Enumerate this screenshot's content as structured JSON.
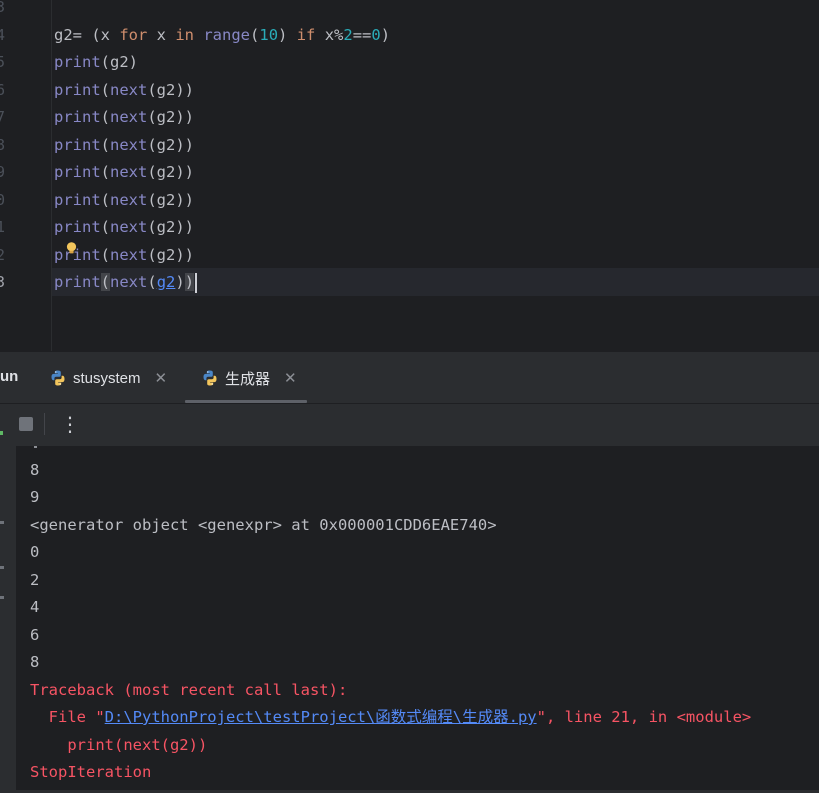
{
  "editor": {
    "line_numbers": [
      "3",
      "4",
      "5",
      "6",
      "7",
      "8",
      "9",
      "0",
      "1",
      "2",
      "3"
    ],
    "lines": [
      {
        "parts": []
      },
      {
        "parts": [
          {
            "t": "g2= (x ",
            "c": ""
          },
          {
            "t": "for",
            "c": "kw"
          },
          {
            "t": " x ",
            "c": ""
          },
          {
            "t": "in",
            "c": "kw"
          },
          {
            "t": " ",
            "c": ""
          },
          {
            "t": "range",
            "c": "bi"
          },
          {
            "t": "(",
            "c": ""
          },
          {
            "t": "10",
            "c": "num"
          },
          {
            "t": ") ",
            "c": ""
          },
          {
            "t": "if",
            "c": "kw"
          },
          {
            "t": " x%",
            "c": ""
          },
          {
            "t": "2",
            "c": "num"
          },
          {
            "t": "==",
            "c": ""
          },
          {
            "t": "0",
            "c": "num"
          },
          {
            "t": ")",
            "c": ""
          }
        ]
      },
      {
        "parts": [
          {
            "t": "print",
            "c": "bi"
          },
          {
            "t": "(g2)",
            "c": ""
          }
        ]
      },
      {
        "parts": [
          {
            "t": "print",
            "c": "bi"
          },
          {
            "t": "(",
            "c": ""
          },
          {
            "t": "next",
            "c": "bi"
          },
          {
            "t": "(g2))",
            "c": ""
          }
        ]
      },
      {
        "parts": [
          {
            "t": "print",
            "c": "bi"
          },
          {
            "t": "(",
            "c": ""
          },
          {
            "t": "next",
            "c": "bi"
          },
          {
            "t": "(g2))",
            "c": ""
          }
        ]
      },
      {
        "parts": [
          {
            "t": "print",
            "c": "bi"
          },
          {
            "t": "(",
            "c": ""
          },
          {
            "t": "next",
            "c": "bi"
          },
          {
            "t": "(g2))",
            "c": ""
          }
        ]
      },
      {
        "parts": [
          {
            "t": "print",
            "c": "bi"
          },
          {
            "t": "(",
            "c": ""
          },
          {
            "t": "next",
            "c": "bi"
          },
          {
            "t": "(g2))",
            "c": ""
          }
        ]
      },
      {
        "parts": [
          {
            "t": "print",
            "c": "bi"
          },
          {
            "t": "(",
            "c": ""
          },
          {
            "t": "next",
            "c": "bi"
          },
          {
            "t": "(g2))",
            "c": ""
          }
        ]
      },
      {
        "parts": [
          {
            "t": "print",
            "c": "bi"
          },
          {
            "t": "(",
            "c": ""
          },
          {
            "t": "next",
            "c": "bi"
          },
          {
            "t": "(g2))",
            "c": ""
          }
        ]
      },
      {
        "parts": [
          {
            "t": "print",
            "c": "bi"
          },
          {
            "t": "(",
            "c": ""
          },
          {
            "t": "next",
            "c": "bi"
          },
          {
            "t": "(g2))",
            "c": ""
          }
        ]
      },
      {
        "parts": [
          {
            "t": "print",
            "c": "bi"
          },
          {
            "t": "(",
            "c": "brace-hl"
          },
          {
            "t": "next",
            "c": "bi"
          },
          {
            "t": "(",
            "c": ""
          },
          {
            "t": "g2",
            "c": "link-id"
          },
          {
            "t": ")",
            "c": ""
          },
          {
            "t": ")",
            "c": "brace-hl"
          }
        ]
      }
    ],
    "bulb_icon": "lightbulb-icon"
  },
  "run_window": {
    "title_fragment": "un",
    "tabs": [
      {
        "label": "stusystem",
        "icon": "python-icon",
        "close": "✕"
      },
      {
        "label": "生成器",
        "icon": "python-icon",
        "close": "✕"
      }
    ],
    "toolbar": {
      "stop_icon": "stop-icon",
      "more_icon": "more-vertical-icon",
      "more_glyph": "⋮"
    },
    "output": [
      {
        "text": "8",
        "type": "normal"
      },
      {
        "text": "9",
        "type": "normal"
      },
      {
        "text": "<generator object <genexpr> at 0x000001CDD6EAE740>",
        "type": "normal"
      },
      {
        "text": "0",
        "type": "normal"
      },
      {
        "text": "2",
        "type": "normal"
      },
      {
        "text": "4",
        "type": "normal"
      },
      {
        "text": "6",
        "type": "normal"
      },
      {
        "text": "8",
        "type": "normal"
      },
      {
        "text": "Traceback (most recent call last):",
        "type": "err"
      }
    ],
    "traceback_file": {
      "prefix": "  File \"",
      "path": "D:\\PythonProject\\testProject\\函数式编程\\生成器.py",
      "suffix": "\", line 21, in <module>"
    },
    "traceback_code": "    print(next(g2))",
    "error_name": "StopIteration"
  },
  "colors": {
    "editor_bg": "#1e1f22",
    "panel_bg": "#2b2d30",
    "keyword": "#cf8e6d",
    "builtin": "#8888c6",
    "number": "#2aacb8",
    "error": "#f75464",
    "link": "#548af7"
  }
}
